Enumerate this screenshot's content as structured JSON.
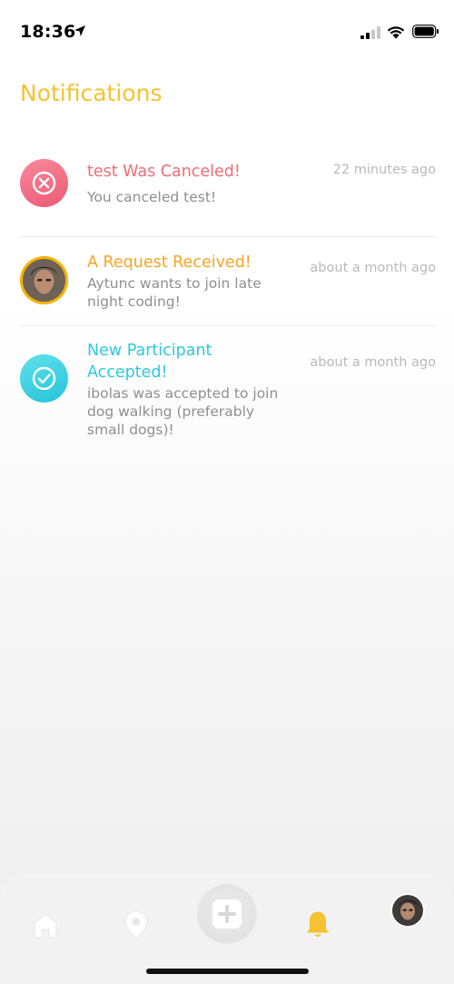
{
  "status_bar": {
    "time": "18:36",
    "icons": [
      "location-arrow-icon",
      "cellular-signal-icon",
      "wifi-icon",
      "battery-icon"
    ]
  },
  "page": {
    "title": "Notifications"
  },
  "notifications": [
    {
      "icon": "cancel-x-icon",
      "accent": "#f06b76",
      "title": "test Was Canceled!",
      "body": "You canceled test!",
      "time": "22 minutes ago"
    },
    {
      "icon": "user-avatar",
      "accent": "#f5a623",
      "title": "A Request Received!",
      "body": "Aytunc wants to join late night coding!",
      "time": "about a month ago"
    },
    {
      "icon": "check-circle-icon",
      "accent": "#2ec9dc",
      "title": "New Participant Accepted!",
      "body": "ibolas was accepted to join dog walking (preferably small dogs)!",
      "time": "about a month ago"
    }
  ],
  "tab_bar": {
    "items": [
      {
        "name": "home",
        "icon": "home-icon",
        "active": false
      },
      {
        "name": "map",
        "icon": "location-pin-icon",
        "active": false
      },
      {
        "name": "create",
        "icon": "add-plus-icon",
        "active": false
      },
      {
        "name": "notifications",
        "icon": "bell-icon",
        "active": true
      },
      {
        "name": "profile",
        "icon": "profile-avatar",
        "active": false
      }
    ],
    "active_color": "#f6c232",
    "inactive_color": "#ffffff"
  }
}
